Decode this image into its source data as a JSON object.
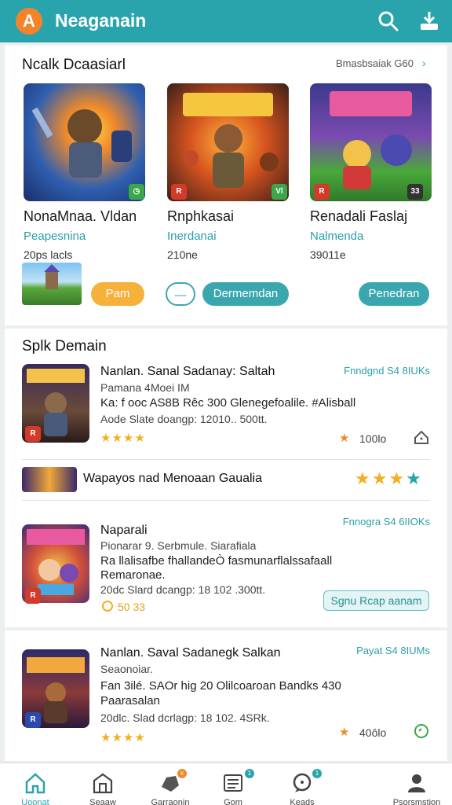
{
  "header": {
    "logo_letter": "A",
    "title": "Neaganain"
  },
  "featured": {
    "title": "Ncalk Dcaasiarl",
    "see_all": "Bmasbsaiak G60",
    "cards": [
      {
        "name": "NonaMnaa. Vldan",
        "subtitle": "Peapesnina",
        "meta": "20ps lacls",
        "badge": "◷"
      },
      {
        "name": "Rnphkasai",
        "subtitle": "Inerdanai",
        "meta": "210ne",
        "badge": "Vl"
      },
      {
        "name": "Renadali Faslaj",
        "subtitle": "Nalmenda",
        "meta": "39011e",
        "badge": "33"
      }
    ],
    "buttons": {
      "orange": "Pam",
      "outline": "—",
      "teal1": "Dermemdan",
      "teal2": "Penedran"
    }
  },
  "split_section": {
    "title": "Splk Demain",
    "items": [
      {
        "title": "Nanlan. Sanal Sadanay: Saltah",
        "line1": "Pamana 4Moei IM",
        "line2": "Ka: f ooc AS8B Rêc 300 Glenegefoalile. #Alisball",
        "line3": "Aode Slate doangp: 12010.. 500tt.",
        "price": "Fnndgnd S4 8IUKs",
        "rating": "100lo"
      },
      {
        "banner": "Wapayos nad Menoaan Gaualia"
      },
      {
        "title": "Naparali",
        "line1": "Pionarar 9. Serbmule. Siarafiala",
        "line2": "Ra llalisafbe fhallandeÒ fasmunarflalssafaall",
        "line2b": "Remaronae.",
        "line3": "20dc Slard dcangp: 18 102 .300tt.",
        "price": "Fnnogra S4 6IIOKs",
        "coins": "50 33",
        "button": "Sgnu Rcap aanam"
      },
      {
        "title": "Nanlan. Saval Sadanegk Salkan",
        "line1": "Seaonoiar.",
        "line2": "Fan 3ilé. SAOr hig 20 Olilcoaroan Bandks 430",
        "line2b": "Paarasalan",
        "line3": "20dlc. Slad dcrlagp: 18 102. 4SRk.",
        "price": "Payat S4 8IUMs",
        "rating": "40ôlo"
      }
    ]
  },
  "bottom_nav": [
    {
      "label": "Uoonat",
      "icon": "home-icon"
    },
    {
      "label": "Seaaw",
      "icon": "store-icon"
    },
    {
      "label": "Garraonin",
      "icon": "game-icon",
      "badge": "x"
    },
    {
      "label": "Gom",
      "icon": "list-icon",
      "badge": "1"
    },
    {
      "label": "Keads",
      "icon": "chat-icon",
      "badge": "1"
    },
    {
      "label": "Psorsmstion",
      "icon": "profile-icon"
    }
  ],
  "colors": {
    "brand": "#2aa4ac",
    "accent_orange": "#f6b13b",
    "star": "#f2b01e"
  }
}
